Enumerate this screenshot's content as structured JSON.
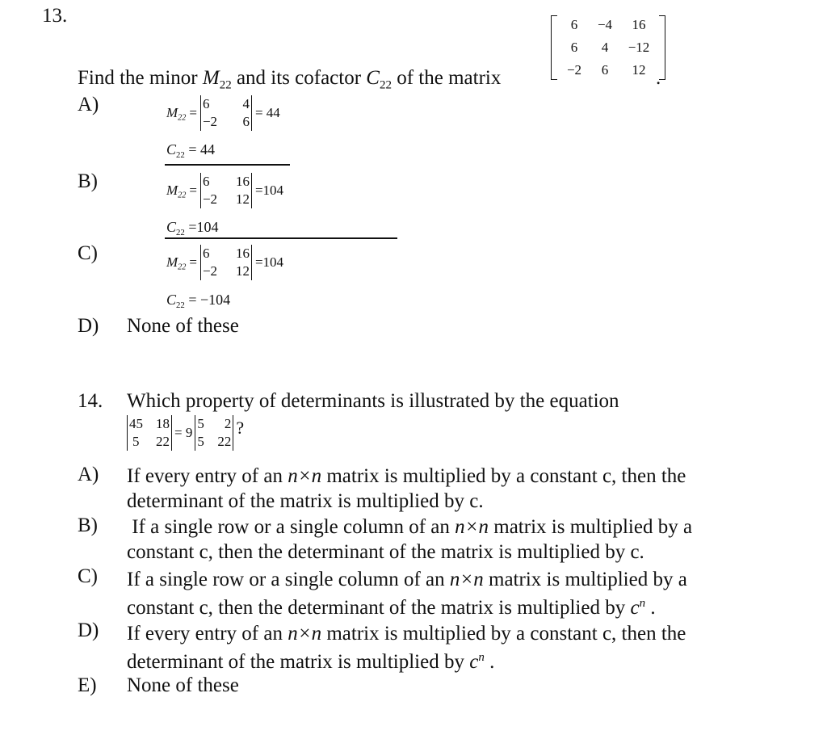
{
  "q13": {
    "number": "13.",
    "prompt_before_m": "Find the minor ",
    "m_symbol": "M",
    "m_sub": "22",
    "prompt_mid": " and its cofactor ",
    "c_symbol": "C",
    "c_sub": "22",
    "prompt_after": " of the matrix",
    "trailing_period": ".",
    "matrix": [
      [
        "6",
        "−4",
        "16"
      ],
      [
        "6",
        "4",
        "−12"
      ],
      [
        "−2",
        "6",
        "12"
      ]
    ],
    "options": [
      {
        "label": "A)",
        "minor_lhs": "M",
        "minor_sub": "22",
        "det": [
          [
            "6",
            "4"
          ],
          [
            "−2",
            "6"
          ]
        ],
        "minor_value": "= 44",
        "cofactor_lhs": "C",
        "cofactor_sub": "22",
        "cofactor_value": "= 44"
      },
      {
        "label": "B)",
        "minor_lhs": "M",
        "minor_sub": "22",
        "det": [
          [
            "6",
            "16"
          ],
          [
            "−2",
            "12"
          ]
        ],
        "minor_value": "=104",
        "cofactor_lhs": "C",
        "cofactor_sub": "22",
        "cofactor_value": "=104"
      },
      {
        "label": "C)",
        "minor_lhs": "M",
        "minor_sub": "22",
        "det": [
          [
            "6",
            "16"
          ],
          [
            "−2",
            "12"
          ]
        ],
        "minor_value": "=104",
        "cofactor_lhs": "C",
        "cofactor_sub": "22",
        "cofactor_value": "= −104"
      },
      {
        "label": "D)",
        "text": "None of these"
      }
    ]
  },
  "q14": {
    "number": "14.",
    "prompt": "Which property of determinants is illustrated by the equation",
    "lhs_det": [
      [
        "45",
        "18"
      ],
      [
        "5",
        "22"
      ]
    ],
    "equals": "= 9",
    "rhs_det": [
      [
        "5",
        "2"
      ],
      [
        "5",
        "22"
      ]
    ],
    "question_mark": "?",
    "options": [
      {
        "label": "A)",
        "line1_pre": "If every entry of an ",
        "nxn": "n×n",
        "line1_post": " matrix is multiplied by a constant c, then the",
        "line2": "determinant of the matrix is multiplied by c.",
        "power": ""
      },
      {
        "label": "B)",
        "line1_pre": " If a single row or a single column of an ",
        "nxn": "n×n",
        "line1_post": " matrix is multiplied by a",
        "line2": "constant c, then the determinant of the matrix is multiplied by c.",
        "power": ""
      },
      {
        "label": "C)",
        "line1_pre": "If a single row or a single column of an ",
        "nxn": "n×n",
        "line1_post": " matrix is multiplied by a",
        "line2": "constant c, then the determinant of the matrix is multiplied by ",
        "power_base": "c",
        "power": "n",
        "end": " ."
      },
      {
        "label": "D)",
        "line1_pre": "If every entry of an ",
        "nxn": "n×n",
        "line1_post": " matrix is multiplied by a constant c, then the",
        "line2": "determinant of the matrix is multiplied by ",
        "power_base": "c",
        "power": "n",
        "end": " ."
      },
      {
        "label": "E)",
        "line1_pre": "None of these"
      }
    ]
  }
}
